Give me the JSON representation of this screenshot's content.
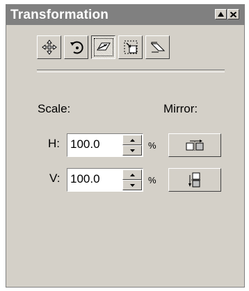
{
  "window": {
    "title": "Transformation"
  },
  "titlebar_buttons": {
    "maximize_icon": "maximize-icon",
    "close_icon": "close-icon"
  },
  "toolbar": {
    "tools": [
      {
        "name": "position",
        "icon": "move-arrows-icon"
      },
      {
        "name": "rotate",
        "icon": "rotate-icon"
      },
      {
        "name": "scale-mirror",
        "icon": "scale-icon",
        "active": true
      },
      {
        "name": "size",
        "icon": "size-icon"
      },
      {
        "name": "skew",
        "icon": "skew-icon"
      }
    ]
  },
  "scale": {
    "label": "Scale:",
    "h_label": "H:",
    "h_value": "100.0",
    "v_label": "V:",
    "v_value": "100.0",
    "unit": "%"
  },
  "mirror": {
    "label": "Mirror:",
    "horizontal_icon": "mirror-horizontal-icon",
    "vertical_icon": "mirror-vertical-icon"
  },
  "colors": {
    "face": "#d4d0c8",
    "titlebar": "#808080",
    "title_text": "#ffffff"
  }
}
